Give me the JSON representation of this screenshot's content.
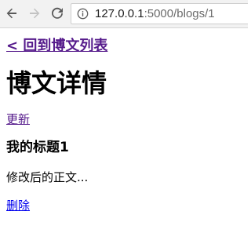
{
  "browser": {
    "url_host": "127.0.0.1",
    "url_path": ":5000/blogs/1",
    "icons": {
      "back": "arrow-left-icon",
      "forward": "arrow-right-icon",
      "reload": "reload-icon",
      "info": "info-icon"
    }
  },
  "page": {
    "back_link": "< 回到博文列表",
    "title": "博文详情",
    "update_link": "更新",
    "blog_title": "我的标题1",
    "blog_body": "修改后的正文...",
    "delete_link": "删除"
  },
  "colors": {
    "visited_link": "#551a8b",
    "link": "#0000ee"
  }
}
